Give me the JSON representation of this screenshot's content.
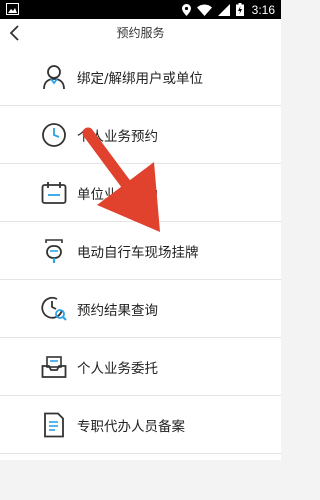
{
  "status_bar": {
    "time": "3:16",
    "icons": [
      "location-icon",
      "wifi-icon",
      "signal-icon",
      "battery-charging-icon"
    ]
  },
  "nav": {
    "title": "预约服务",
    "back_icon": "chevron-left-icon"
  },
  "menu": {
    "items": [
      {
        "label": "绑定/解绑用户或单位",
        "icon": "user-icon"
      },
      {
        "label": "个人业务预约",
        "icon": "clock-icon"
      },
      {
        "label": "单位业务预约",
        "icon": "calendar-icon"
      },
      {
        "label": "电动自行车现场挂牌",
        "icon": "ebike-icon"
      },
      {
        "label": "预约结果查询",
        "icon": "clock-search-icon"
      },
      {
        "label": "个人业务委托",
        "icon": "inbox-icon"
      },
      {
        "label": "专职代办人员备案",
        "icon": "document-icon"
      }
    ]
  },
  "colors": {
    "icon_dark": "#333333",
    "icon_accent": "#2aa3e8",
    "annotation_arrow": "#e0422e"
  }
}
